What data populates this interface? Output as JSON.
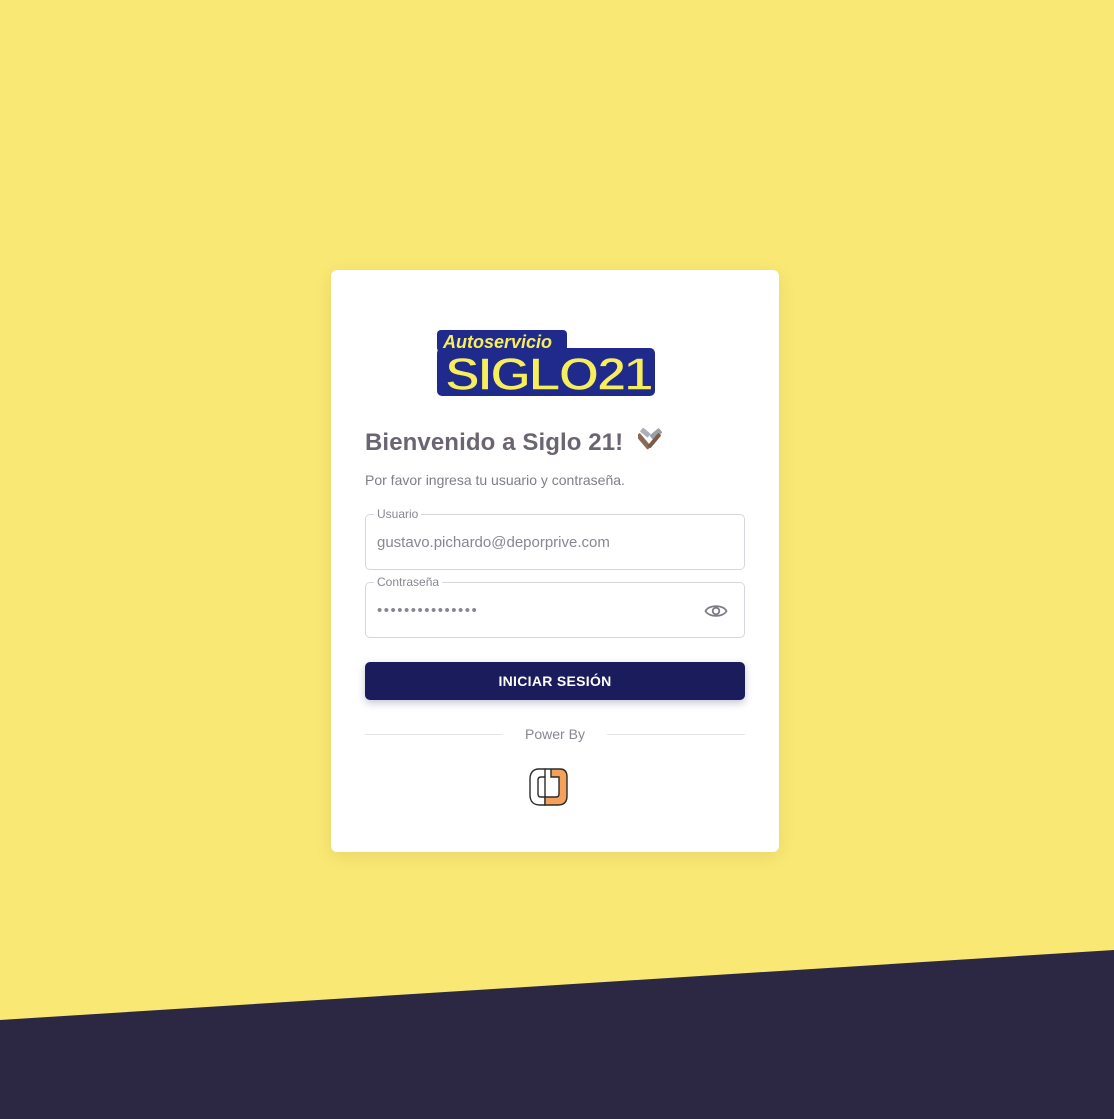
{
  "colors": {
    "background": "#f9e873",
    "bottom_band": "#2c2843",
    "button": "#1a1c5c",
    "logo_blue": "#1f2a8c",
    "logo_yellow": "#f7ee5c",
    "brand_orange": "#f4a25b"
  },
  "logo": {
    "top_text": "Autoservicio",
    "main_text": "SIGLO21"
  },
  "login": {
    "title": "Bienvenido a Siglo 21!",
    "title_icon": "hammer-and-wrench-icon",
    "subtitle": "Por favor ingresa tu usuario y contraseña.",
    "username_label": "Usuario",
    "username_value": "gustavo.pichardo@deporprive.com",
    "password_label": "Contraseña",
    "password_value": "•••••••••••••••",
    "password_toggle_icon": "eye-icon",
    "submit_label": "INICIAR SESIÓN",
    "powered_by": "Power By",
    "brand_icon": "cj-brand-logo"
  }
}
